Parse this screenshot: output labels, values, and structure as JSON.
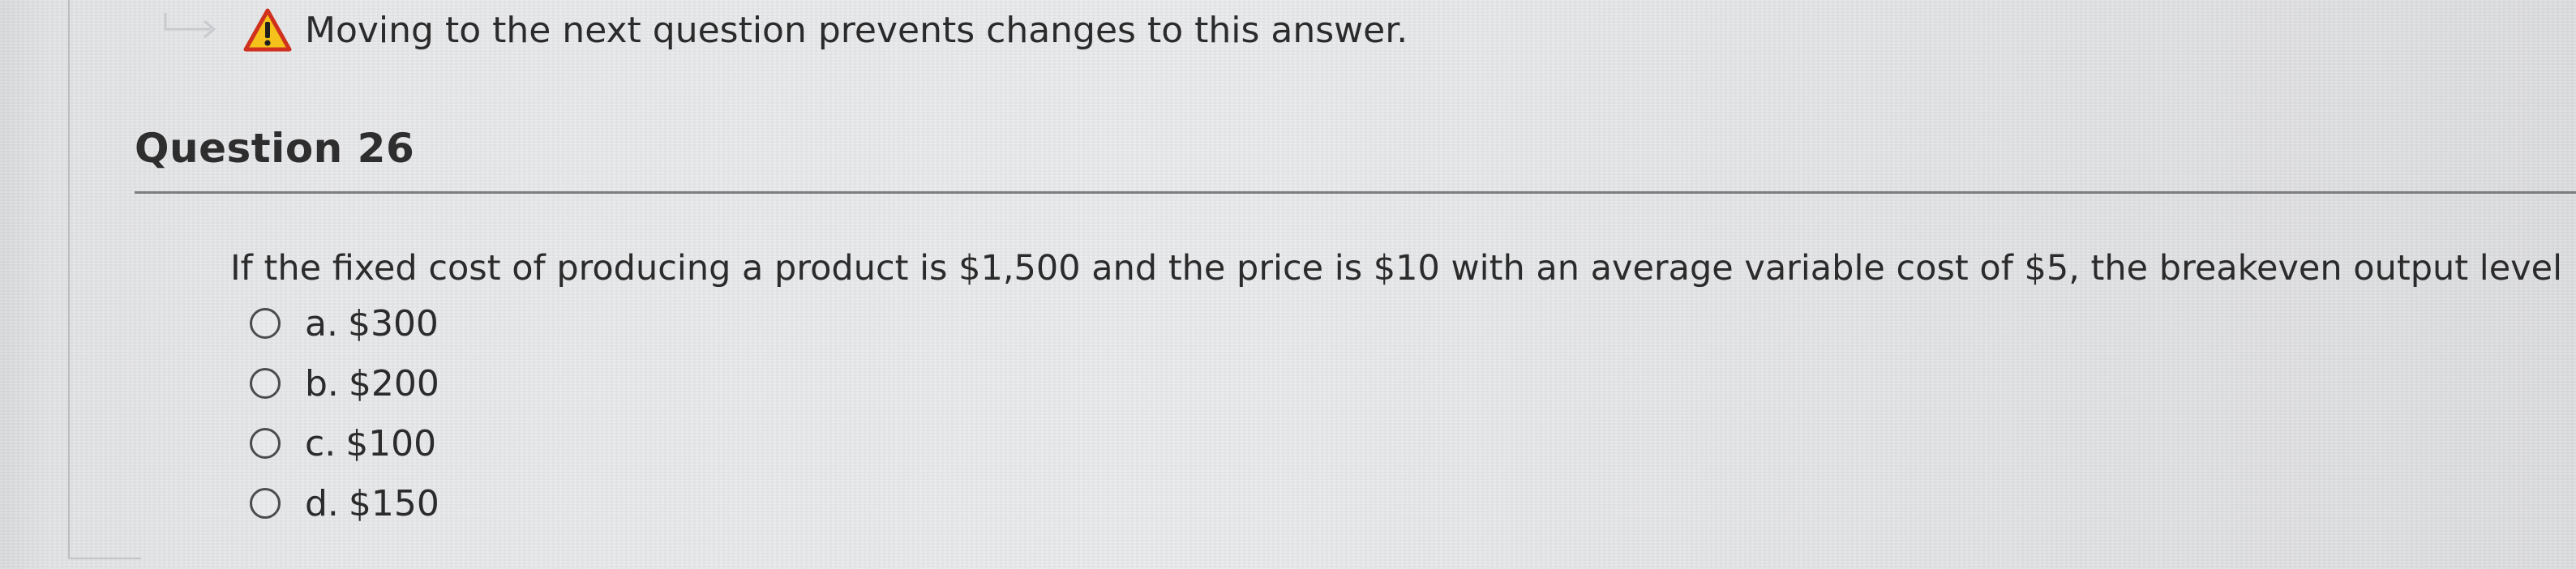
{
  "notice": {
    "text": "Moving to the next question prevents changes to this answer.",
    "icon": "warning-icon"
  },
  "question": {
    "title": "Question 26",
    "prompt": "If the fixed cost of producing a product is $1,500 and the price is $10 with an average variable cost of $5, the breakeven output level is",
    "options": [
      {
        "letter": "a.",
        "value": "$300"
      },
      {
        "letter": "b.",
        "value": "$200"
      },
      {
        "letter": "c.",
        "value": "$100"
      },
      {
        "letter": "d.",
        "value": "$150"
      }
    ]
  },
  "colors": {
    "warning_fill": "#f5c21b",
    "warning_outline": "#d0311f",
    "divider": "#7d7e82"
  }
}
